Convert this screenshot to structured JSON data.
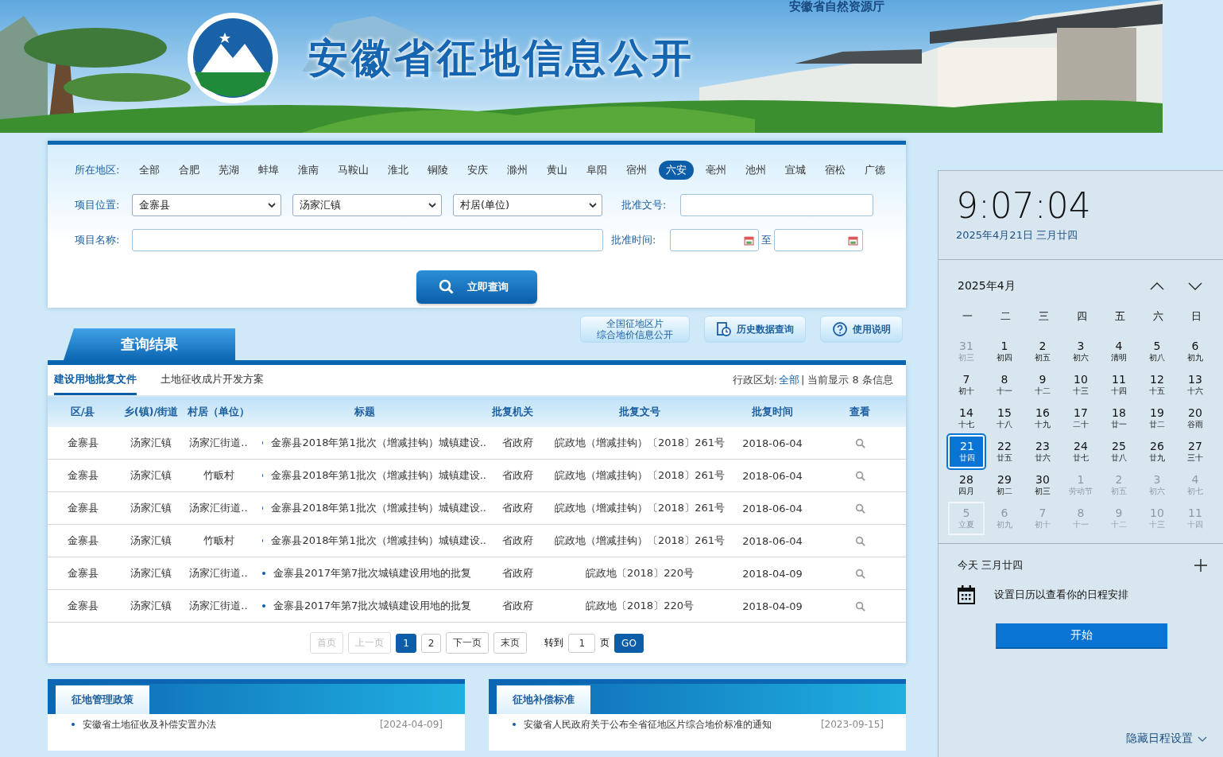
{
  "header": {
    "title": "安徽省征地信息公开",
    "subtitle": "安徽省自然资源厅"
  },
  "search": {
    "region_label": "所在地区:",
    "regions": [
      {
        "label": "全部",
        "selected": false
      },
      {
        "label": "合肥",
        "selected": false
      },
      {
        "label": "芜湖",
        "selected": false
      },
      {
        "label": "蚌埠",
        "selected": false
      },
      {
        "label": "淮南",
        "selected": false
      },
      {
        "label": "马鞍山",
        "selected": false
      },
      {
        "label": "淮北",
        "selected": false
      },
      {
        "label": "铜陵",
        "selected": false
      },
      {
        "label": "安庆",
        "selected": false
      },
      {
        "label": "滁州",
        "selected": false
      },
      {
        "label": "黄山",
        "selected": false
      },
      {
        "label": "阜阳",
        "selected": false
      },
      {
        "label": "宿州",
        "selected": false
      },
      {
        "label": "六安",
        "selected": true
      },
      {
        "label": "亳州",
        "selected": false
      },
      {
        "label": "池州",
        "selected": false
      },
      {
        "label": "宣城",
        "selected": false
      },
      {
        "label": "宿松",
        "selected": false
      },
      {
        "label": "广德",
        "selected": false
      }
    ],
    "location_label": "项目位置:",
    "selects": [
      {
        "value": "金寨县"
      },
      {
        "value": "汤家汇镇"
      },
      {
        "value": "村居(单位)"
      }
    ],
    "approval_no_label": "批准文号:",
    "name_label": "项目名称:",
    "time_label": "批准时间:",
    "to": "至",
    "button": "立即查询"
  },
  "results": {
    "title": "查询结果",
    "land_price_link": [
      "全国征地区片",
      "综合地价信息公开"
    ],
    "history_button": "历史数据查询",
    "help_button": "使用说明",
    "subtabs": [
      {
        "label": "建设用地批复文件",
        "selected": true
      },
      {
        "label": "土地征收成片开发方案",
        "selected": false
      }
    ],
    "info_label": "行政区划:",
    "info_link": "全部",
    "info_text": "| 当前显示 8 条信息"
  },
  "table": {
    "columns": [
      "区/县",
      "乡(镇)/街道",
      "村居（单位）",
      "标题",
      "批复机关",
      "批复文号",
      "批复时间",
      "查看"
    ],
    "rows": [
      [
        "金寨县",
        "汤家汇镇",
        "汤家汇街道..",
        "金寨县2018年第1批次（增减挂钩）城镇建设..",
        "省政府",
        "皖政地（增减挂钩）〔2018〕261号",
        "2018-06-04"
      ],
      [
        "金寨县",
        "汤家汇镇",
        "竹畈村",
        "金寨县2018年第1批次（增减挂钩）城镇建设..",
        "省政府",
        "皖政地（增减挂钩）〔2018〕261号",
        "2018-06-04"
      ],
      [
        "金寨县",
        "汤家汇镇",
        "汤家汇街道..",
        "金寨县2018年第1批次（增减挂钩）城镇建设..",
        "省政府",
        "皖政地（增减挂钩）〔2018〕261号",
        "2018-06-04"
      ],
      [
        "金寨县",
        "汤家汇镇",
        "竹畈村",
        "金寨县2018年第1批次（增减挂钩）城镇建设..",
        "省政府",
        "皖政地（增减挂钩）〔2018〕261号",
        "2018-06-04"
      ],
      [
        "金寨县",
        "汤家汇镇",
        "汤家汇街道..",
        "金寨县2017年第7批次城镇建设用地的批复",
        "省政府",
        "皖政地〔2018〕220号",
        "2018-04-09"
      ],
      [
        "金寨县",
        "汤家汇镇",
        "汤家汇街道..",
        "金寨县2017年第7批次城镇建设用地的批复",
        "省政府",
        "皖政地〔2018〕220号",
        "2018-04-09"
      ]
    ]
  },
  "pagination": {
    "pages": [
      {
        "label": "首页",
        "disabled": true,
        "selected": false
      },
      {
        "label": "上一页",
        "disabled": true,
        "selected": false
      },
      {
        "label": "1",
        "disabled": false,
        "selected": true
      },
      {
        "label": "2",
        "disabled": false,
        "selected": false
      },
      {
        "label": "下一页",
        "disabled": false,
        "selected": false
      },
      {
        "label": "末页",
        "disabled": false,
        "selected": false
      }
    ],
    "goto_label": "转到",
    "goto_value": "1",
    "page_unit": "页",
    "go_button": "GO"
  },
  "panels": [
    {
      "title": "征地管理政策",
      "items": [
        {
          "text": "安徽省土地征收及补偿安置办法",
          "date": "[2024-04-09]"
        }
      ]
    },
    {
      "title": "征地补偿标准",
      "items": [
        {
          "text": "安徽省人民政府关于公布全省征地区片综合地价标准的通知",
          "date": "[2023-09-15]"
        }
      ]
    }
  ],
  "flyout": {
    "time": "9:07:04",
    "date": "2025年4月21日 三月廿四",
    "month": "2025年4月",
    "weekdays": [
      "一",
      "二",
      "三",
      "四",
      "五",
      "六",
      "日"
    ],
    "days": [
      {
        "day": "31",
        "lunar": "初三",
        "muted": true,
        "selected": false,
        "outlined": false
      },
      {
        "day": "1",
        "lunar": "初四",
        "muted": false,
        "selected": false,
        "outlined": false
      },
      {
        "day": "2",
        "lunar": "初五",
        "muted": false,
        "selected": false,
        "outlined": false
      },
      {
        "day": "3",
        "lunar": "初六",
        "muted": false,
        "selected": false,
        "outlined": false
      },
      {
        "day": "4",
        "lunar": "清明",
        "muted": false,
        "selected": false,
        "outlined": false
      },
      {
        "day": "5",
        "lunar": "初八",
        "muted": false,
        "selected": false,
        "outlined": false
      },
      {
        "day": "6",
        "lunar": "初九",
        "muted": false,
        "selected": false,
        "outlined": false
      },
      {
        "day": "7",
        "lunar": "初十",
        "muted": false,
        "selected": false,
        "outlined": false
      },
      {
        "day": "8",
        "lunar": "十一",
        "muted": false,
        "selected": false,
        "outlined": false
      },
      {
        "day": "9",
        "lunar": "十二",
        "muted": false,
        "selected": false,
        "outlined": false
      },
      {
        "day": "10",
        "lunar": "十三",
        "muted": false,
        "selected": false,
        "outlined": false
      },
      {
        "day": "11",
        "lunar": "十四",
        "muted": false,
        "selected": false,
        "outlined": false
      },
      {
        "day": "12",
        "lunar": "十五",
        "muted": false,
        "selected": false,
        "outlined": false
      },
      {
        "day": "13",
        "lunar": "十六",
        "muted": false,
        "selected": false,
        "outlined": false
      },
      {
        "day": "14",
        "lunar": "十七",
        "muted": false,
        "selected": false,
        "outlined": false
      },
      {
        "day": "15",
        "lunar": "十八",
        "muted": false,
        "selected": false,
        "outlined": false
      },
      {
        "day": "16",
        "lunar": "十九",
        "muted": false,
        "selected": false,
        "outlined": false
      },
      {
        "day": "17",
        "lunar": "二十",
        "muted": false,
        "selected": false,
        "outlined": false
      },
      {
        "day": "18",
        "lunar": "廿一",
        "muted": false,
        "selected": false,
        "outlined": false
      },
      {
        "day": "19",
        "lunar": "廿二",
        "muted": false,
        "selected": false,
        "outlined": false
      },
      {
        "day": "20",
        "lunar": "谷雨",
        "muted": false,
        "selected": false,
        "outlined": false
      },
      {
        "day": "21",
        "lunar": "廿四",
        "muted": false,
        "selected": true,
        "outlined": false
      },
      {
        "day": "22",
        "lunar": "廿五",
        "muted": false,
        "selected": false,
        "outlined": false
      },
      {
        "day": "23",
        "lunar": "廿六",
        "muted": false,
        "selected": false,
        "outlined": false
      },
      {
        "day": "24",
        "lunar": "廿七",
        "muted": false,
        "selected": false,
        "outlined": false
      },
      {
        "day": "25",
        "lunar": "廿八",
        "muted": false,
        "selected": false,
        "outlined": false
      },
      {
        "day": "26",
        "lunar": "廿九",
        "muted": false,
        "selected": false,
        "outlined": false
      },
      {
        "day": "27",
        "lunar": "三十",
        "muted": false,
        "selected": false,
        "outlined": false
      },
      {
        "day": "28",
        "lunar": "四月",
        "muted": false,
        "selected": false,
        "outlined": false
      },
      {
        "day": "29",
        "lunar": "初二",
        "muted": false,
        "selected": false,
        "outlined": false
      },
      {
        "day": "30",
        "lunar": "初三",
        "muted": false,
        "selected": false,
        "outlined": false
      },
      {
        "day": "1",
        "lunar": "劳动节",
        "muted": true,
        "selected": false,
        "outlined": false
      },
      {
        "day": "2",
        "lunar": "初五",
        "muted": true,
        "selected": false,
        "outlined": false
      },
      {
        "day": "3",
        "lunar": "初六",
        "muted": true,
        "selected": false,
        "outlined": false
      },
      {
        "day": "4",
        "lunar": "初七",
        "muted": true,
        "selected": false,
        "outlined": false
      },
      {
        "day": "5",
        "lunar": "立夏",
        "muted": true,
        "selected": false,
        "outlined": true
      },
      {
        "day": "6",
        "lunar": "初九",
        "muted": true,
        "selected": false,
        "outlined": false
      },
      {
        "day": "7",
        "lunar": "初十",
        "muted": true,
        "selected": false,
        "outlined": false
      },
      {
        "day": "8",
        "lunar": "十一",
        "muted": true,
        "selected": false,
        "outlined": false
      },
      {
        "day": "9",
        "lunar": "十二",
        "muted": true,
        "selected": false,
        "outlined": false
      },
      {
        "day": "10",
        "lunar": "十三",
        "muted": true,
        "selected": false,
        "outlined": false
      },
      {
        "day": "11",
        "lunar": "十四",
        "muted": true,
        "selected": false,
        "outlined": false
      }
    ],
    "today": "今天 三月廿四",
    "message": "设置日历以查看你的日程安排",
    "start_button": "开始",
    "hide_link": "隐藏日程设置"
  }
}
